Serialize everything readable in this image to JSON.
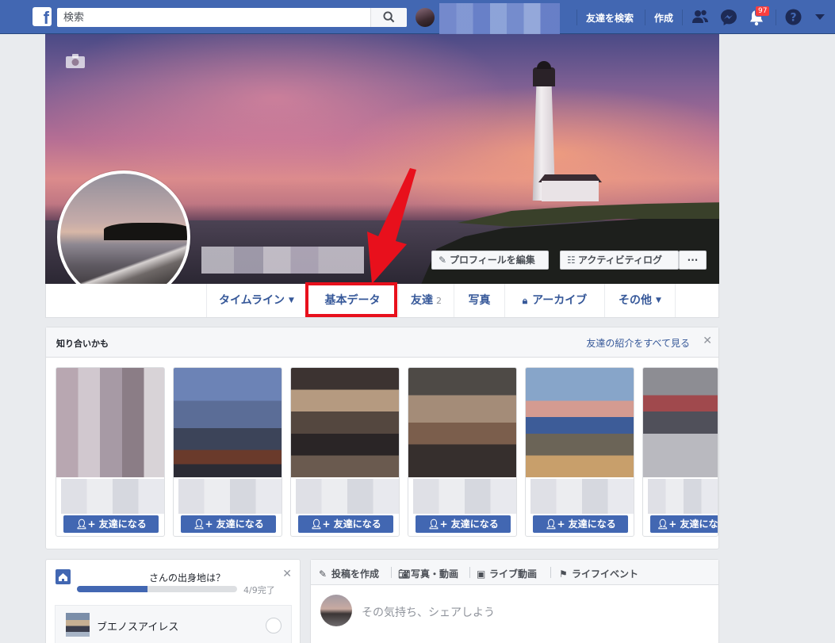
{
  "topbar": {
    "search_placeholder": "検索",
    "find_friends": "友達を検索",
    "create": "作成",
    "notification_count": "97"
  },
  "cover": {
    "edit_profile": "プロフィールを編集",
    "activity_log": "アクティビティログ",
    "more": "···"
  },
  "tabs": [
    {
      "label": "タイムライン"
    },
    {
      "label": "基本データ"
    },
    {
      "label": "友達",
      "count": "2"
    },
    {
      "label": "写真"
    },
    {
      "label": "アーカイブ"
    },
    {
      "label": "その他"
    }
  ],
  "pymk": {
    "title": "知り合いかも",
    "see_all": "友達の紹介をすべて見る",
    "add_friend": "友達になる"
  },
  "intro": {
    "question": "さんの出身地は？",
    "progress_text": "4/9完了",
    "progress_fraction": 0.44,
    "city": "ブエノスアイレス"
  },
  "composer": {
    "create_post": "投稿を作成",
    "photo_video": "写真・動画",
    "live_video": "ライブ動画",
    "life_event": "ライフイベント",
    "placeholder": "その気持ち、シェアしよう"
  },
  "colors": {
    "brand": "#4267b2",
    "highlight": "#e8101c",
    "link": "#365899"
  }
}
